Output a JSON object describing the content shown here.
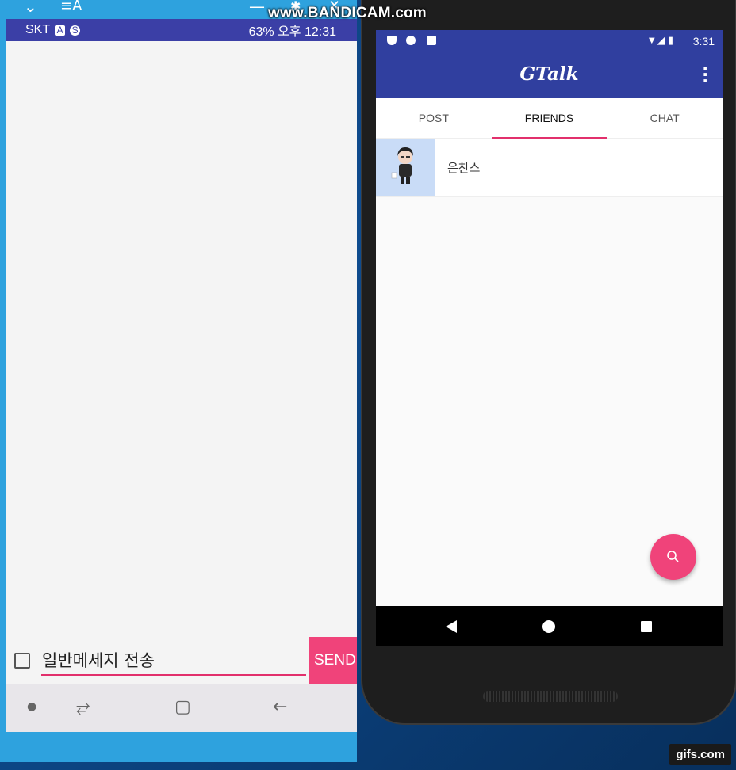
{
  "watermark": "www.BANDICAM.com",
  "gifs_badge": "gifs.com",
  "left": {
    "status": {
      "carrier": "SKT",
      "right_text": "63%  오후 12:31"
    },
    "compose": {
      "text": "일반메세지 전송",
      "send_label": "SEND"
    }
  },
  "right": {
    "status_time": "3:31",
    "app_title": "GTalk",
    "tabs": [
      "POST",
      "FRIENDS",
      "CHAT"
    ],
    "active_tab": "FRIENDS",
    "friends": [
      {
        "name": "은찬스"
      }
    ],
    "fab_icon": "search-icon",
    "colors": {
      "primary": "#303f9f",
      "accent": "#f0437a",
      "avatar_bg": "#c9dcf7"
    }
  }
}
